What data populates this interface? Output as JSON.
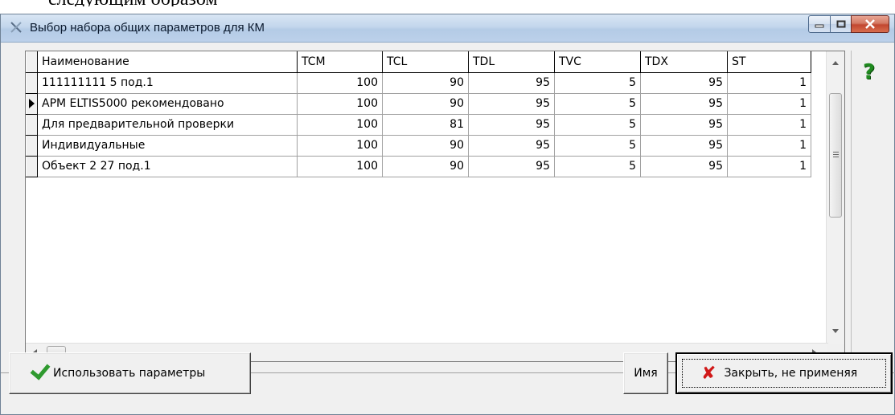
{
  "document": {
    "fragment_text": "следующим образом"
  },
  "window": {
    "title": "Выбор набора общих параметров для КМ"
  },
  "grid": {
    "columns": [
      "Наименование",
      "TCM",
      "TCL",
      "TDL",
      "TVC",
      "TDX",
      "ST"
    ],
    "rows": [
      {
        "name": "111111111 5 под.1",
        "tcm": "100",
        "tcl": "90",
        "tdl": "95",
        "tvc": "5",
        "tdx": "95",
        "st": "1",
        "current": false
      },
      {
        "name": "АРМ ELTIS5000 рекомендовано",
        "tcm": "100",
        "tcl": "90",
        "tdl": "95",
        "tvc": "5",
        "tdx": "95",
        "st": "1",
        "current": true
      },
      {
        "name": "Для предварительной проверки",
        "tcm": "100",
        "tcl": "81",
        "tdl": "95",
        "tvc": "5",
        "tdx": "95",
        "st": "1",
        "current": false
      },
      {
        "name": "Индивидуальные",
        "tcm": "100",
        "tcl": "90",
        "tdl": "95",
        "tvc": "5",
        "tdx": "95",
        "st": "1",
        "current": false
      },
      {
        "name": "Объект 2 27 под.1",
        "tcm": "100",
        "tcl": "90",
        "tdl": "95",
        "tvc": "5",
        "tdx": "95",
        "st": "1",
        "current": false
      }
    ]
  },
  "help": {
    "glyph": "?"
  },
  "buttons": {
    "use_params": "Использовать параметры",
    "name": "Имя",
    "close_no_apply": "Закрыть, не применяя"
  },
  "colors": {
    "help_green": "#1f8a1f",
    "close_red": "#d01818",
    "check_green": "#2f9a2f"
  }
}
